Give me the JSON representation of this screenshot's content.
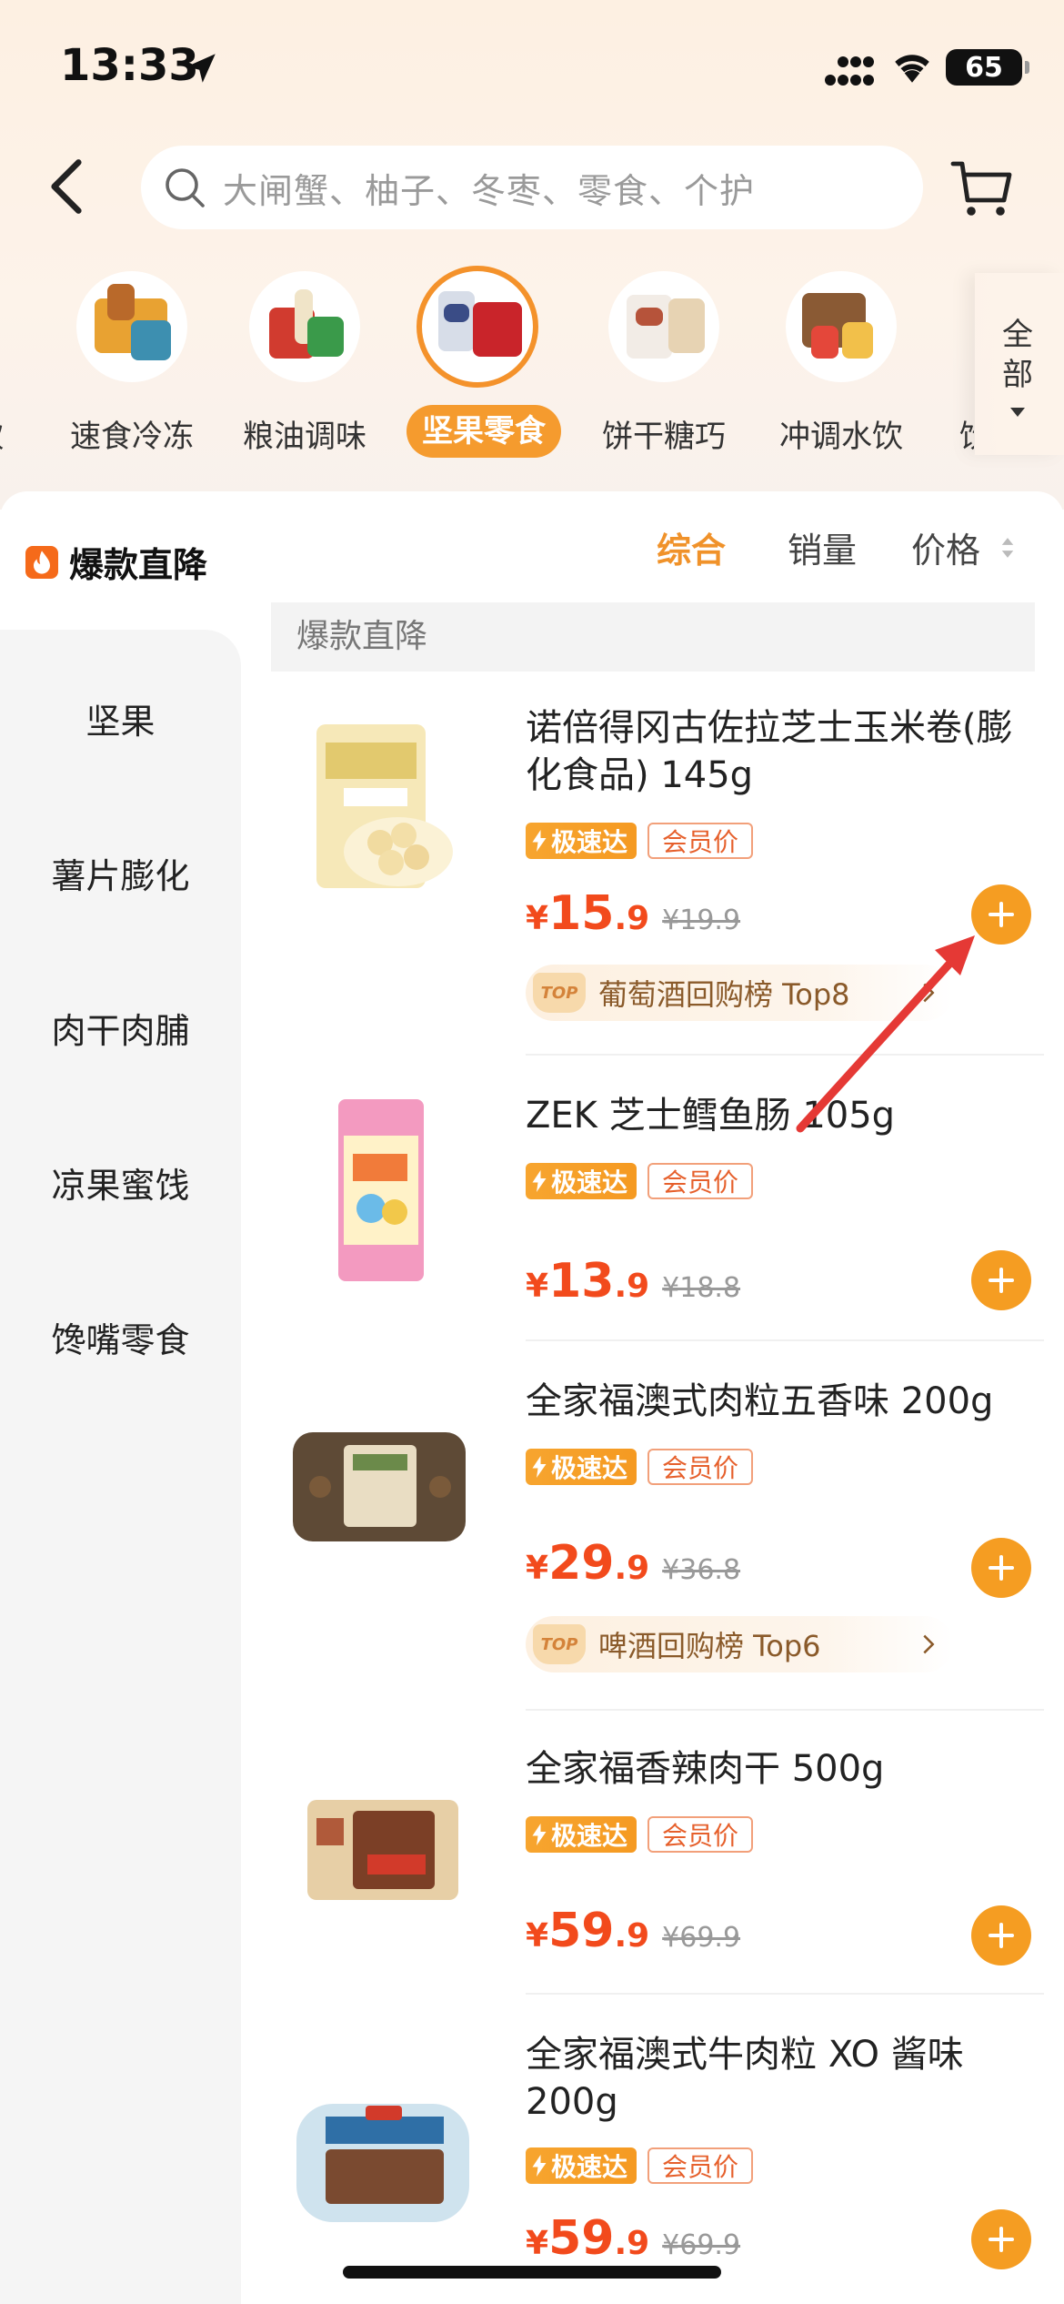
{
  "status_bar": {
    "time": "13:33",
    "battery": "65"
  },
  "search": {
    "placeholder": "大闸蟹、柚子、冬枣、零食、个护"
  },
  "categories": {
    "left_edge": "饮",
    "items": [
      {
        "label": "速食冷冻"
      },
      {
        "label": "粮油调味"
      },
      {
        "label": "坚果零食",
        "active": true
      },
      {
        "label": "饼干糖巧"
      },
      {
        "label": "冲调水饮"
      }
    ],
    "right_edge": "饮",
    "all_label_1": "全",
    "all_label_2": "部"
  },
  "toolbar": {
    "hot_title": "爆款直降",
    "sort_options": [
      "综合",
      "销量",
      "价格"
    ],
    "active_sort": "综合"
  },
  "sidebar": {
    "items": [
      "坚果",
      "薯片膨化",
      "肉干肉脯",
      "凉果蜜饯",
      "馋嘴零食"
    ]
  },
  "section_header": "爆款直降",
  "tags": {
    "fast": "极速达",
    "vip": "会员价"
  },
  "products": [
    {
      "name": "诺倍得冈古佐拉芝士玉米卷(膨化食品) 145g",
      "price_int": "15",
      "price_dec": ".9",
      "price_old": "¥19.9",
      "rank": "葡萄酒回购榜 Top8"
    },
    {
      "name": "ZEK 芝士鳕鱼肠 105g",
      "price_int": "13",
      "price_dec": ".9",
      "price_old": "¥18.8"
    },
    {
      "name": "全家福澳式肉粒五香味 200g",
      "price_int": "29",
      "price_dec": ".9",
      "price_old": "¥36.8",
      "rank": "啤酒回购榜 Top6"
    },
    {
      "name": "全家福香辣肉干 500g",
      "price_int": "59",
      "price_dec": ".9",
      "price_old": "¥69.9"
    },
    {
      "name": "全家福澳式牛肉粒 XO 酱味 200g",
      "price_int": "59",
      "price_dec": ".9",
      "price_old": "¥69.9"
    }
  ],
  "currency": "¥",
  "rank_badge": "TOP",
  "colors": {
    "accent": "#f59b2e",
    "price": "#f24a1c",
    "annotation_arrow": "#e53935"
  }
}
